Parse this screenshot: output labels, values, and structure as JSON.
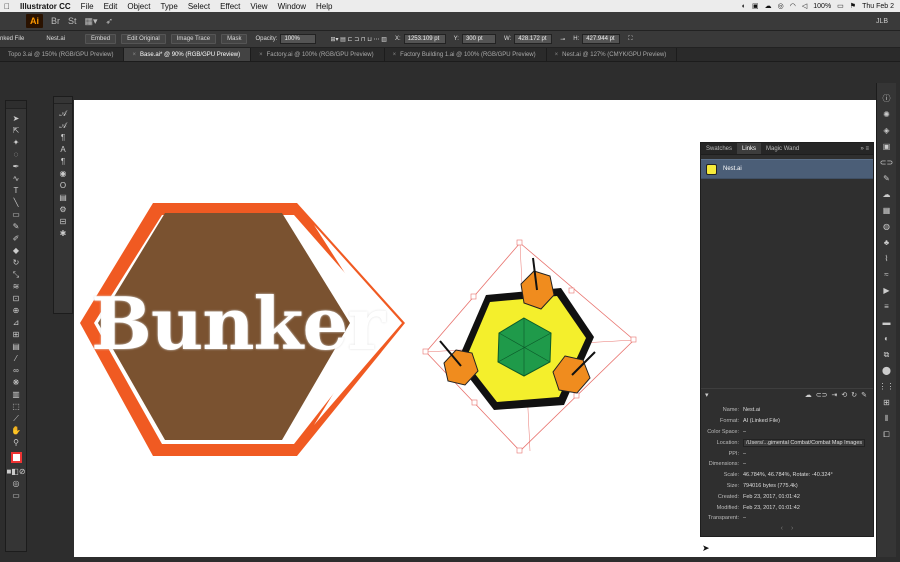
{
  "menubar": {
    "apple": "",
    "items": [
      "Illustrator CC",
      "File",
      "Edit",
      "Object",
      "Type",
      "Select",
      "Effect",
      "View",
      "Window",
      "Help"
    ],
    "battery": "100%",
    "clock": "Thu Feb 2"
  },
  "appbar": {
    "logo": "Ai",
    "br": "Br",
    "st": "St",
    "user": "JLB"
  },
  "control": {
    "linked_file": "nked File",
    "file_name": "Nest.ai",
    "embed": "Embed",
    "edit_original": "Edit Original",
    "image_trace": "Image Trace",
    "mask": "Mask",
    "opacity_label": "Opacity:",
    "opacity": "100%",
    "x_label": "X:",
    "x": "1253.109 pt",
    "y_label": "Y:",
    "y": "300 pt",
    "w_label": "W:",
    "w": "428.172 pt",
    "h_label": "H:",
    "h": "427.944 pt"
  },
  "tabs": [
    {
      "label": "Topo 3.ai @ 150% (RGB/GPU Preview)",
      "active": false
    },
    {
      "label": "Base.ai* @ 90% (RGB/GPU Preview)",
      "active": true
    },
    {
      "label": "Factory.ai @ 100% (RGB/GPU Preview)",
      "active": false
    },
    {
      "label": "Factory Building 1.ai @ 100% (RGB/GPU Preview)",
      "active": false
    },
    {
      "label": "Nest.ai @ 127% (CMYK/GPU Preview)",
      "active": false
    }
  ],
  "canvas": {
    "bunker_text": "Bunker"
  },
  "panel": {
    "tabs": [
      "Swatches",
      "Links",
      "Magic Wand"
    ],
    "active_tab": "Links",
    "link_item": "Nest.ai",
    "info": [
      {
        "k": "Name:",
        "v": "Nest.ai"
      },
      {
        "k": "Format:",
        "v": "AI (Linked File)"
      },
      {
        "k": "Color Space:",
        "v": "–"
      },
      {
        "k": "Location:",
        "v": "/Users/...gimental Combat/Combat Map Images"
      },
      {
        "k": "PPI:",
        "v": "–"
      },
      {
        "k": "Dimensions:",
        "v": "–"
      },
      {
        "k": "Scale:",
        "v": "46.784%, 46.784%, Rotate: -40.324°"
      },
      {
        "k": "Size:",
        "v": "794016 bytes (775.4k)"
      },
      {
        "k": "Created:",
        "v": "Feb 23, 2017, 01:01:42"
      },
      {
        "k": "Modified:",
        "v": "Feb 23, 2017, 01:01:42"
      },
      {
        "k": "Transparent:",
        "v": "–"
      }
    ]
  },
  "colors": {
    "hex_orange": "#f05a22",
    "hex_brown": "#7a5230",
    "nest_yellow": "#f4ef2c",
    "nest_green": "#1f9a4a",
    "pod_orange": "#f08c1e",
    "selection": "#e8736e",
    "link_highlight": "#4b5e77"
  },
  "icons": {
    "tools": [
      "selection-tool",
      "direct-selection-tool",
      "magic-wand-tool",
      "lasso-tool",
      "pen-tool",
      "curvature-tool",
      "type-tool",
      "line-tool",
      "rectangle-tool",
      "paintbrush-tool",
      "shaper-tool",
      "eraser-tool",
      "rotate-tool",
      "scale-tool",
      "width-tool",
      "free-transform-tool",
      "shape-builder-tool",
      "perspective-grid-tool",
      "mesh-tool",
      "gradient-tool",
      "eyedropper-tool",
      "blend-tool",
      "symbol-sprayer-tool",
      "column-graph-tool",
      "artboard-tool",
      "slice-tool",
      "hand-tool",
      "zoom-tool",
      "fill-stroke-swatch",
      "swap-colors",
      "draw-mode",
      "screen-mode"
    ]
  }
}
